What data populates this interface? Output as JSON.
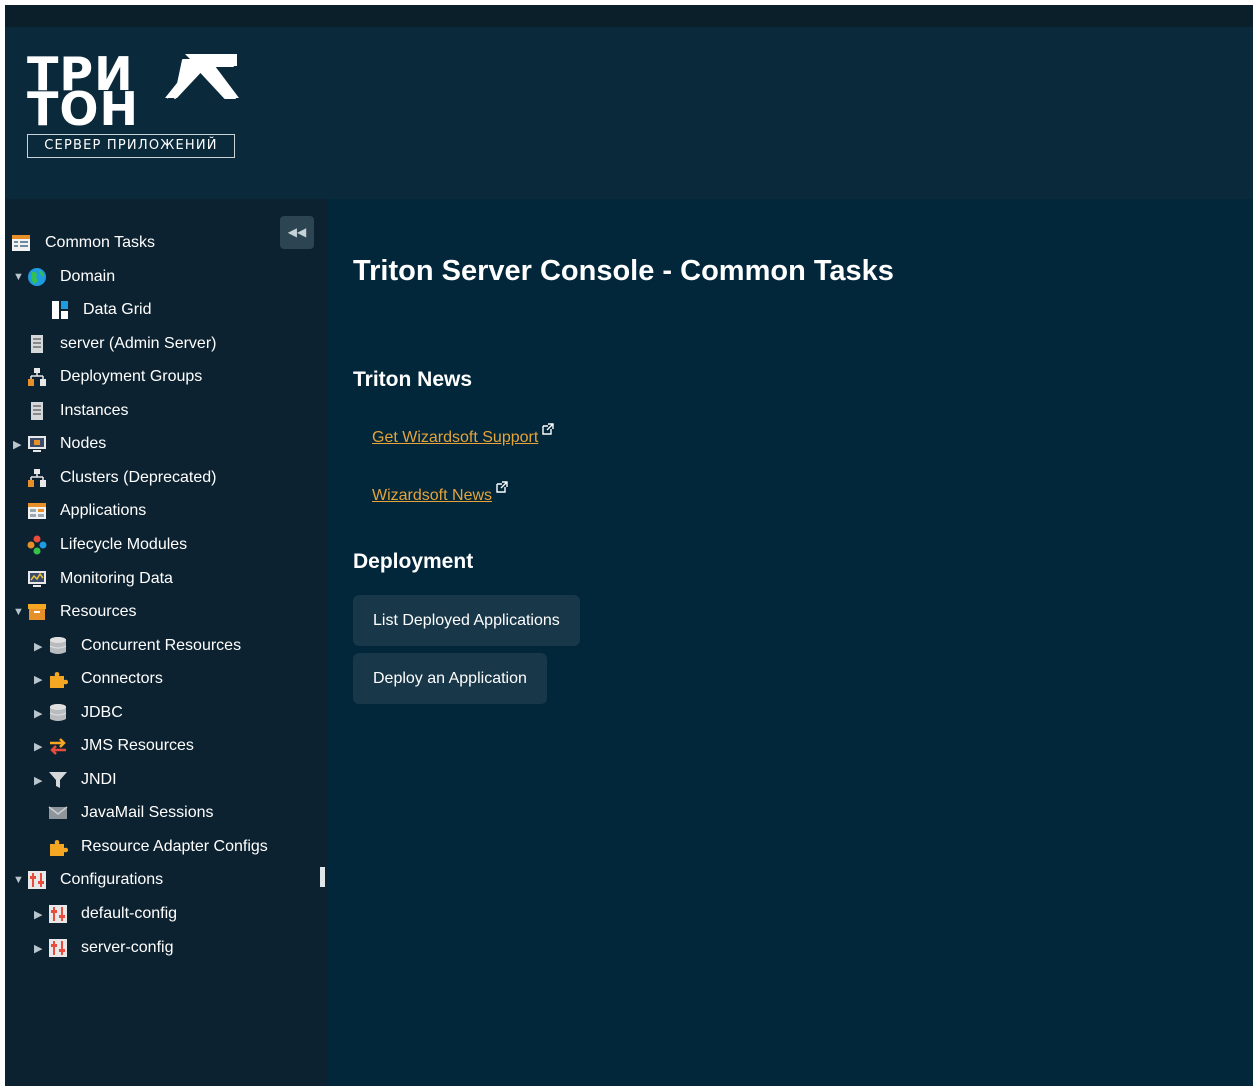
{
  "brand": {
    "logo_line1": "ТРИ",
    "logo_line2": "ТОН",
    "logo_subtitle": "СЕРВЕР ПРИЛОЖЕНИЙ"
  },
  "sidebar": {
    "collapse_icon": "double-chevron-left-icon",
    "items": [
      {
        "label": "Common Tasks",
        "icon": "tasks-icon",
        "twisty": "",
        "level": 0
      },
      {
        "label": "Domain",
        "icon": "globe-icon",
        "twisty": "expanded",
        "level": 0
      },
      {
        "label": "Data Grid",
        "icon": "data-grid-icon",
        "twisty": "",
        "level": 1
      },
      {
        "label": "server (Admin Server)",
        "icon": "server-icon",
        "twisty": "",
        "level": 0
      },
      {
        "label": "Deployment Groups",
        "icon": "hierarchy-icon",
        "twisty": "",
        "level": 0
      },
      {
        "label": "Instances",
        "icon": "server-icon",
        "twisty": "",
        "level": 0
      },
      {
        "label": "Nodes",
        "icon": "monitor-icon",
        "twisty": "collapsed",
        "level": 0
      },
      {
        "label": "Clusters (Deprecated)",
        "icon": "hierarchy-icon",
        "twisty": "",
        "level": 0
      },
      {
        "label": "Applications",
        "icon": "applications-icon",
        "twisty": "",
        "level": 0
      },
      {
        "label": "Lifecycle Modules",
        "icon": "lifecycle-icon",
        "twisty": "",
        "level": 0
      },
      {
        "label": "Monitoring Data",
        "icon": "monitoring-icon",
        "twisty": "",
        "level": 0
      },
      {
        "label": "Resources",
        "icon": "resources-box-icon",
        "twisty": "expanded",
        "level": 0
      },
      {
        "label": "Concurrent Resources",
        "icon": "database-icon",
        "twisty": "collapsed",
        "level": 1
      },
      {
        "label": "Connectors",
        "icon": "puzzle-icon",
        "twisty": "collapsed",
        "level": 1
      },
      {
        "label": "JDBC",
        "icon": "database-icon",
        "twisty": "collapsed",
        "level": 1
      },
      {
        "label": "JMS Resources",
        "icon": "exchange-arrows-icon",
        "twisty": "collapsed",
        "level": 1
      },
      {
        "label": "JNDI",
        "icon": "filter-icon",
        "twisty": "collapsed",
        "level": 1
      },
      {
        "label": "JavaMail Sessions",
        "icon": "mail-icon",
        "twisty": "",
        "level": 1
      },
      {
        "label": "Resource Adapter Configs",
        "icon": "puzzle-icon",
        "twisty": "",
        "level": 1
      },
      {
        "label": "Configurations",
        "icon": "config-sliders-icon",
        "twisty": "expanded",
        "level": 0
      },
      {
        "label": "default-config",
        "icon": "config-sliders-icon",
        "twisty": "collapsed",
        "level": 1
      },
      {
        "label": "server-config",
        "icon": "config-sliders-icon",
        "twisty": "collapsed",
        "level": 1
      }
    ]
  },
  "main": {
    "title": "Triton Server Console - Common Tasks",
    "news": {
      "heading": "Triton News",
      "links": [
        {
          "label": "Get Wizardsoft Support",
          "icon": "external-link-icon"
        },
        {
          "label": "Wizardsoft News",
          "icon": "external-link-icon"
        }
      ]
    },
    "deployment": {
      "heading": "Deployment",
      "buttons": [
        {
          "label": "List Deployed Applications"
        },
        {
          "label": "Deploy an Application"
        }
      ]
    }
  },
  "colors": {
    "header_bg": "#0a2a3c",
    "sidebar_bg": "#0d2230",
    "main_bg": "#02263a",
    "link": "#e4a43a",
    "button_bg": "#183749"
  }
}
